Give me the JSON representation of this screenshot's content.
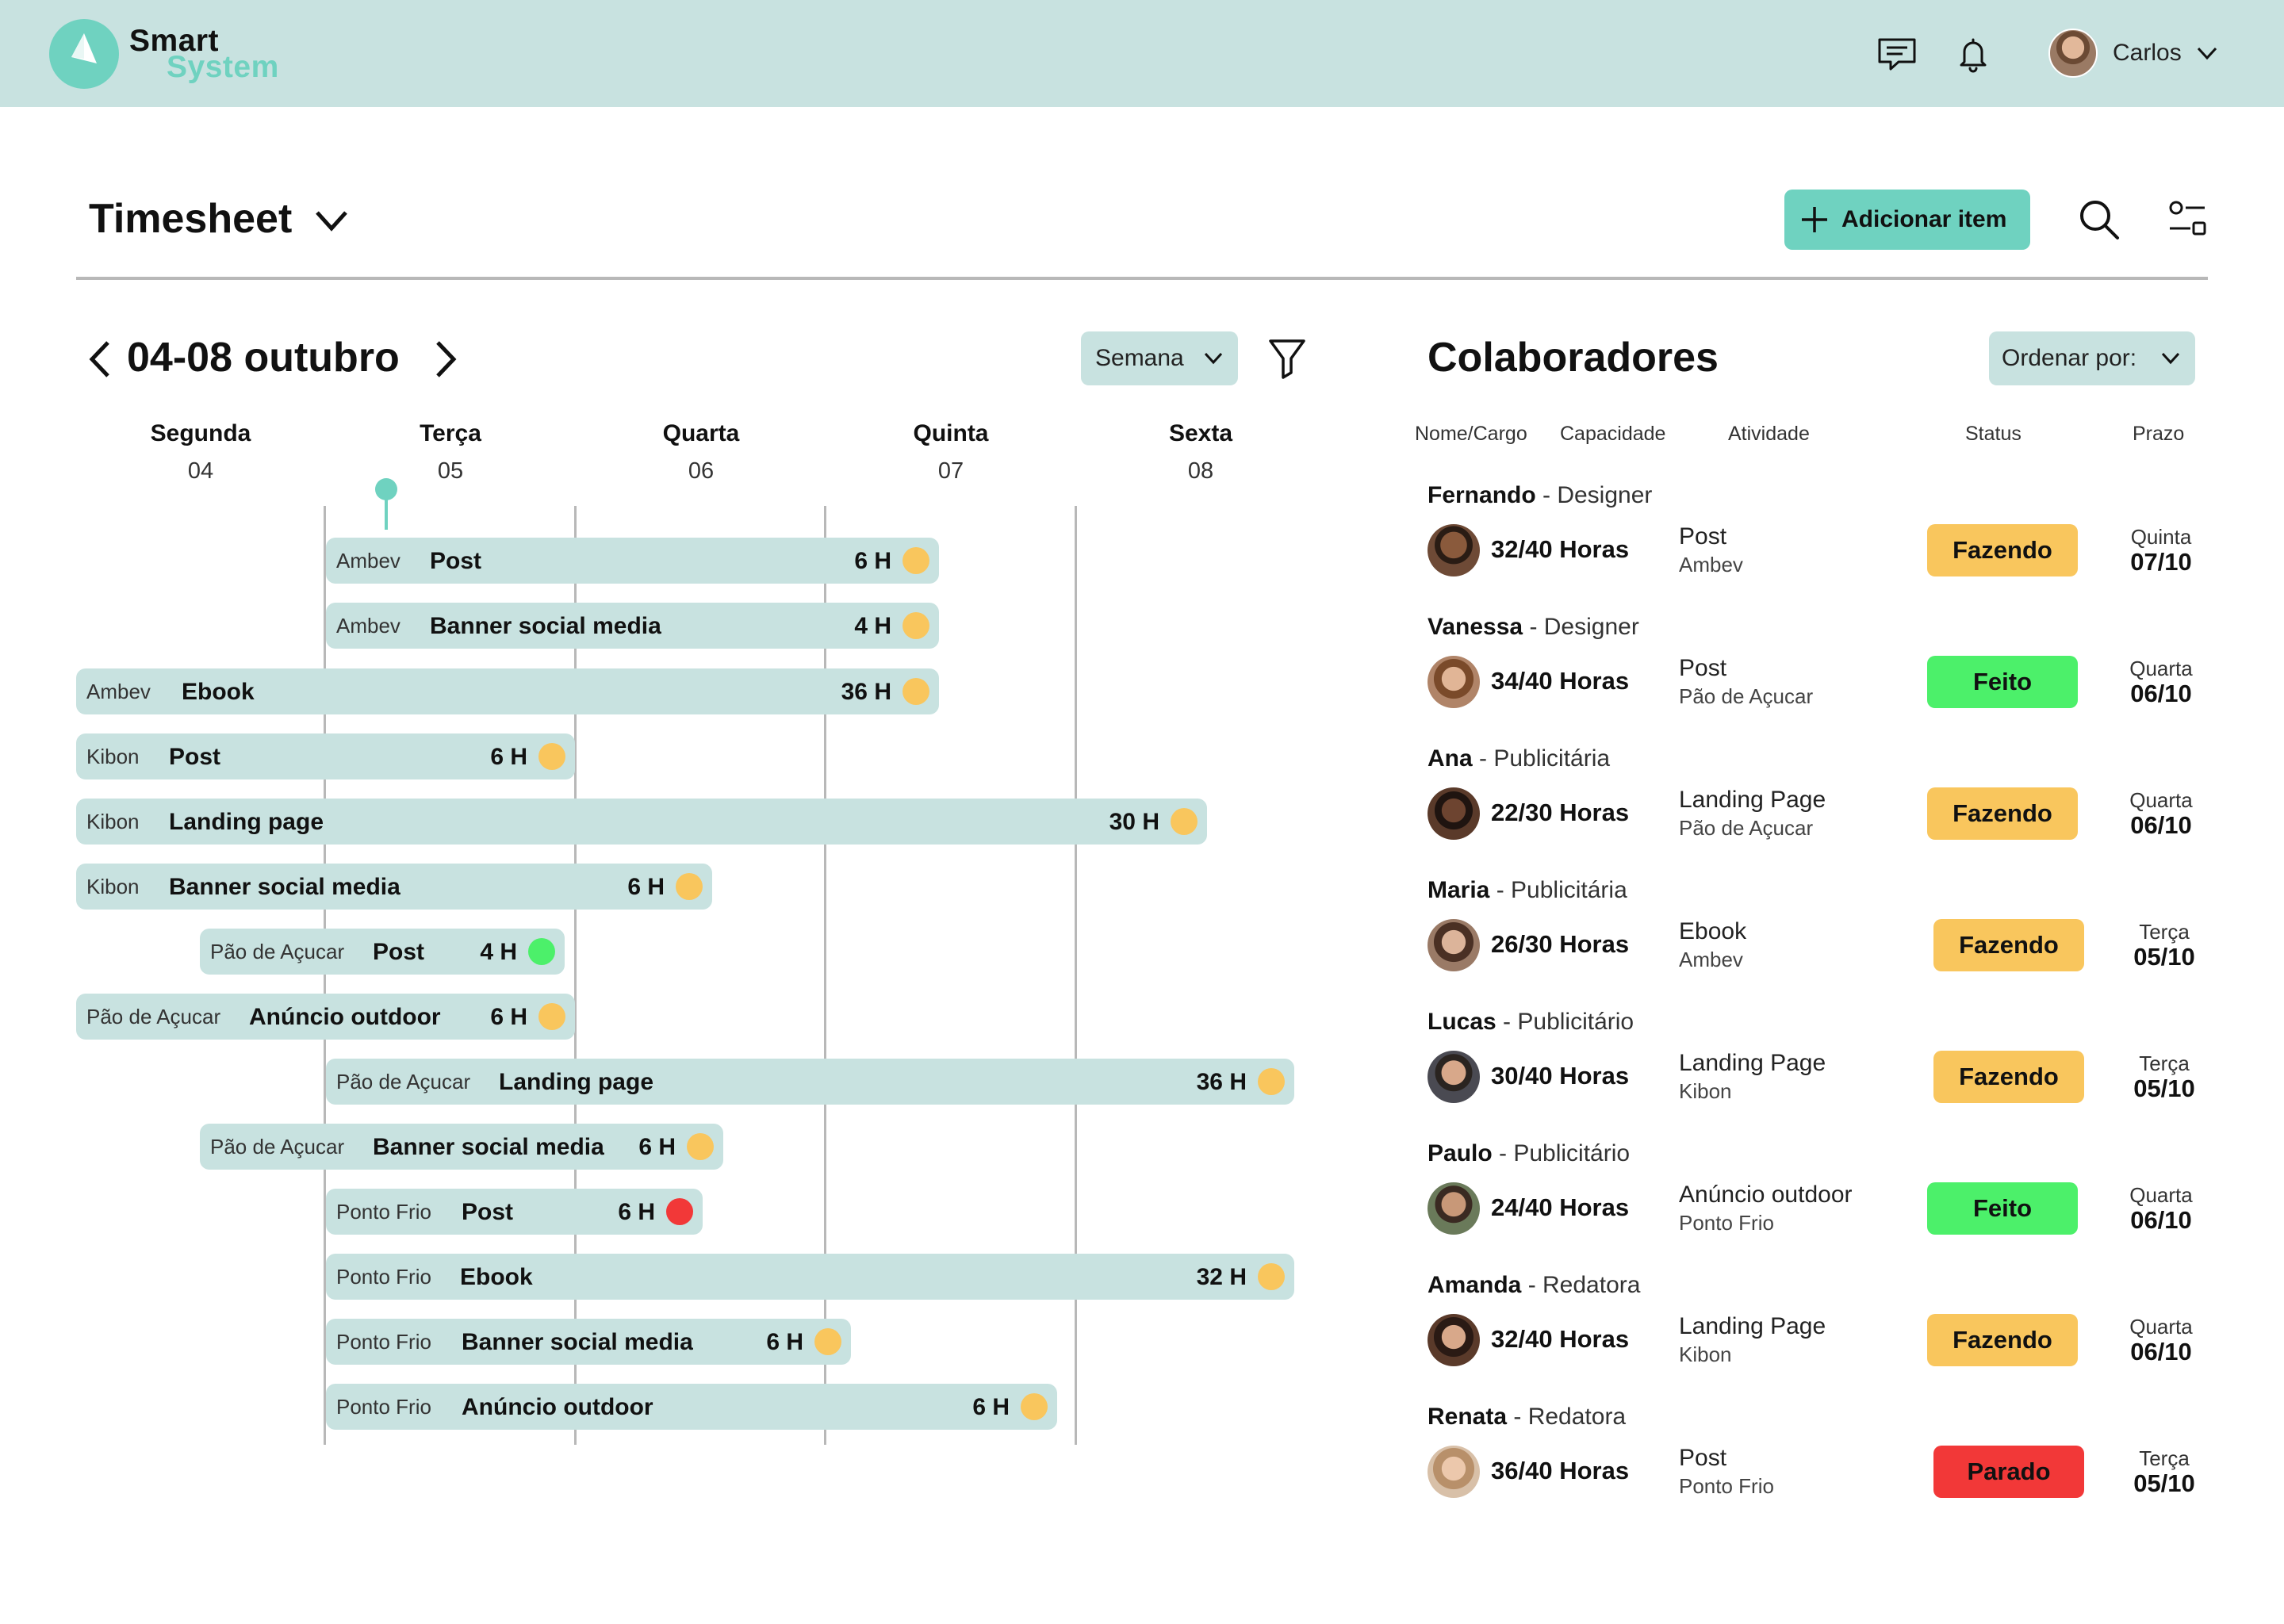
{
  "app": {
    "brand_line1": "Smart",
    "brand_line2": "System",
    "user_name": "Carlos",
    "accent_color": "#6fd2c0",
    "panel_color": "#c8e2e0"
  },
  "header": {
    "title": "Timesheet",
    "add_button_label": "Adicionar item"
  },
  "calendar": {
    "range_label": "04-08 outubro",
    "view_select": "Semana",
    "days": [
      {
        "name": "Segunda",
        "date": "04"
      },
      {
        "name": "Terça",
        "date": "05"
      },
      {
        "name": "Quarta",
        "date": "06"
      },
      {
        "name": "Quinta",
        "date": "07"
      },
      {
        "name": "Sexta",
        "date": "08"
      }
    ],
    "tasks": [
      {
        "client": "Ambev",
        "name": "Post",
        "hours": "6 H",
        "status_color": "#f9c65d"
      },
      {
        "client": "Ambev",
        "name": "Banner social media",
        "hours": "4 H",
        "status_color": "#f9c65d"
      },
      {
        "client": "Ambev",
        "name": "Ebook",
        "hours": "36 H",
        "status_color": "#f9c65d"
      },
      {
        "client": "Kibon",
        "name": "Post",
        "hours": "6 H",
        "status_color": "#f9c65d"
      },
      {
        "client": "Kibon",
        "name": "Landing page",
        "hours": "30 H",
        "status_color": "#f9c65d"
      },
      {
        "client": "Kibon",
        "name": "Banner social media",
        "hours": "6 H",
        "status_color": "#f9c65d"
      },
      {
        "client": "Pão de Açucar",
        "name": "Post",
        "hours": "4 H",
        "status_color": "#4cf06a"
      },
      {
        "client": "Pão de Açucar",
        "name": "Anúncio outdoor",
        "hours": "6 H",
        "status_color": "#f9c65d"
      },
      {
        "client": "Pão de Açucar",
        "name": "Landing page",
        "hours": "36 H",
        "status_color": "#f9c65d"
      },
      {
        "client": "Pão de Açucar",
        "name": "Banner social media",
        "hours": "6 H",
        "status_color": "#f9c65d"
      },
      {
        "client": "Ponto Frio",
        "name": "Post",
        "hours": "6 H",
        "status_color": "#f23838"
      },
      {
        "client": "Ponto Frio",
        "name": "Ebook",
        "hours": "32 H",
        "status_color": "#f9c65d"
      },
      {
        "client": "Ponto Frio",
        "name": "Banner social media",
        "hours": "6 H",
        "status_color": "#f9c65d"
      },
      {
        "client": "Ponto Frio",
        "name": "Anúncio outdoor",
        "hours": "6 H",
        "status_color": "#f9c65d"
      }
    ]
  },
  "collaborators": {
    "title": "Colaboradores",
    "order_select": "Ordenar por:",
    "columns": [
      "Nome/Cargo",
      "Capacidade",
      "Atividade",
      "Status",
      "Prazo"
    ],
    "rows": [
      {
        "name": "Fernando",
        "role": " - Designer",
        "capacity": "32/40 Horas",
        "activity": "Post",
        "client": "Ambev",
        "status": "Fazendo",
        "status_color": "#f9c65d",
        "due_day": "Quinta",
        "due_date": "07/10"
      },
      {
        "name": "Vanessa",
        "role": " - Designer",
        "capacity": "34/40 Horas",
        "activity": "Post",
        "client": "Pão de Açucar",
        "status": "Feito",
        "status_color": "#4cf06a",
        "due_day": "Quarta",
        "due_date": "06/10"
      },
      {
        "name": "Ana",
        "role": " - Publicitária",
        "capacity": "22/30 Horas",
        "activity": "Landing Page",
        "client": "Pão de Açucar",
        "status": "Fazendo",
        "status_color": "#f9c65d",
        "due_day": "Quarta",
        "due_date": "06/10"
      },
      {
        "name": "Maria",
        "role": " - Publicitária",
        "capacity": "26/30 Horas",
        "activity": "Ebook",
        "client": "Ambev",
        "status": "Fazendo",
        "status_color": "#f9c65d",
        "due_day": "Terça",
        "due_date": "05/10"
      },
      {
        "name": "Lucas",
        "role": " - Publicitário",
        "capacity": "30/40 Horas",
        "activity": "Landing Page",
        "client": "Kibon",
        "status": "Fazendo",
        "status_color": "#f9c65d",
        "due_day": "Terça",
        "due_date": "05/10"
      },
      {
        "name": "Paulo",
        "role": " - Publicitário",
        "capacity": "24/40 Horas",
        "activity": "Anúncio outdoor",
        "client": "Ponto Frio",
        "status": "Feito",
        "status_color": "#4cf06a",
        "due_day": "Quarta",
        "due_date": "06/10"
      },
      {
        "name": "Amanda",
        "role": " - Redatora",
        "capacity": "32/40 Horas",
        "activity": "Landing Page",
        "client": "Kibon",
        "status": "Fazendo",
        "status_color": "#f9c65d",
        "due_day": "Quarta",
        "due_date": "06/10"
      },
      {
        "name": "Renata",
        "role": " - Redatora",
        "capacity": "36/40 Horas",
        "activity": "Post",
        "client": "Ponto Frio",
        "status": "Parado",
        "status_color": "#f23838",
        "due_day": "Terça",
        "due_date": "05/10"
      }
    ]
  }
}
